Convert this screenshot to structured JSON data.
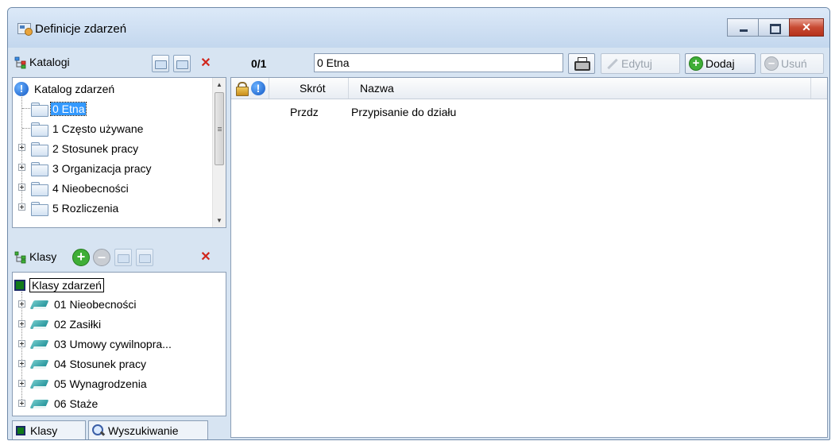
{
  "window": {
    "title": "Definicje zdarzeń"
  },
  "catalogs_panel": {
    "label": "Katalogi",
    "tree": {
      "root": "Katalog zdarzeń",
      "items": [
        {
          "label": "0 Etna",
          "selected": true,
          "expandable": false
        },
        {
          "label": "1 Często używane",
          "selected": false,
          "expandable": false
        },
        {
          "label": "2 Stosunek pracy",
          "selected": false,
          "expandable": true
        },
        {
          "label": "3 Organizacja pracy",
          "selected": false,
          "expandable": true
        },
        {
          "label": "4 Nieobecności",
          "selected": false,
          "expandable": true
        },
        {
          "label": "5 Rozliczenia",
          "selected": false,
          "expandable": true
        }
      ]
    }
  },
  "classes_panel": {
    "label": "Klasy",
    "tree": {
      "root": "Klasy zdarzeń",
      "items": [
        {
          "label": "01 Nieobecności"
        },
        {
          "label": "02 Zasiłki"
        },
        {
          "label": "03 Umowy cywilnopra..."
        },
        {
          "label": "04 Stosunek pracy"
        },
        {
          "label": "05 Wynagrodzenia"
        },
        {
          "label": "06 Staże"
        }
      ]
    }
  },
  "bottom_tabs": [
    "Klasy",
    "Wyszukiwanie"
  ],
  "toolbar": {
    "counter": "0/1",
    "catalog_value": "0 Etna",
    "edit_label": "Edytuj",
    "add_label": "Dodaj",
    "delete_label": "Usuń"
  },
  "grid": {
    "columns": [
      "Skrót",
      "Nazwa"
    ],
    "rows": [
      {
        "short": "Przdz",
        "name": "Przypisanie do działu"
      }
    ]
  },
  "colors": {
    "selection": "#3399ff",
    "add_green": "#3fae37",
    "delete_red": "#d0261c",
    "window_frame": "#d7e4f2"
  },
  "icons": [
    "app-icon",
    "catalogs-tree-icon",
    "classes-tree-icon",
    "info-icon",
    "folder-icon",
    "book-icon",
    "printer-icon",
    "pencil-icon",
    "plus-icon",
    "minus-icon",
    "lock-icon",
    "search-icon"
  ]
}
